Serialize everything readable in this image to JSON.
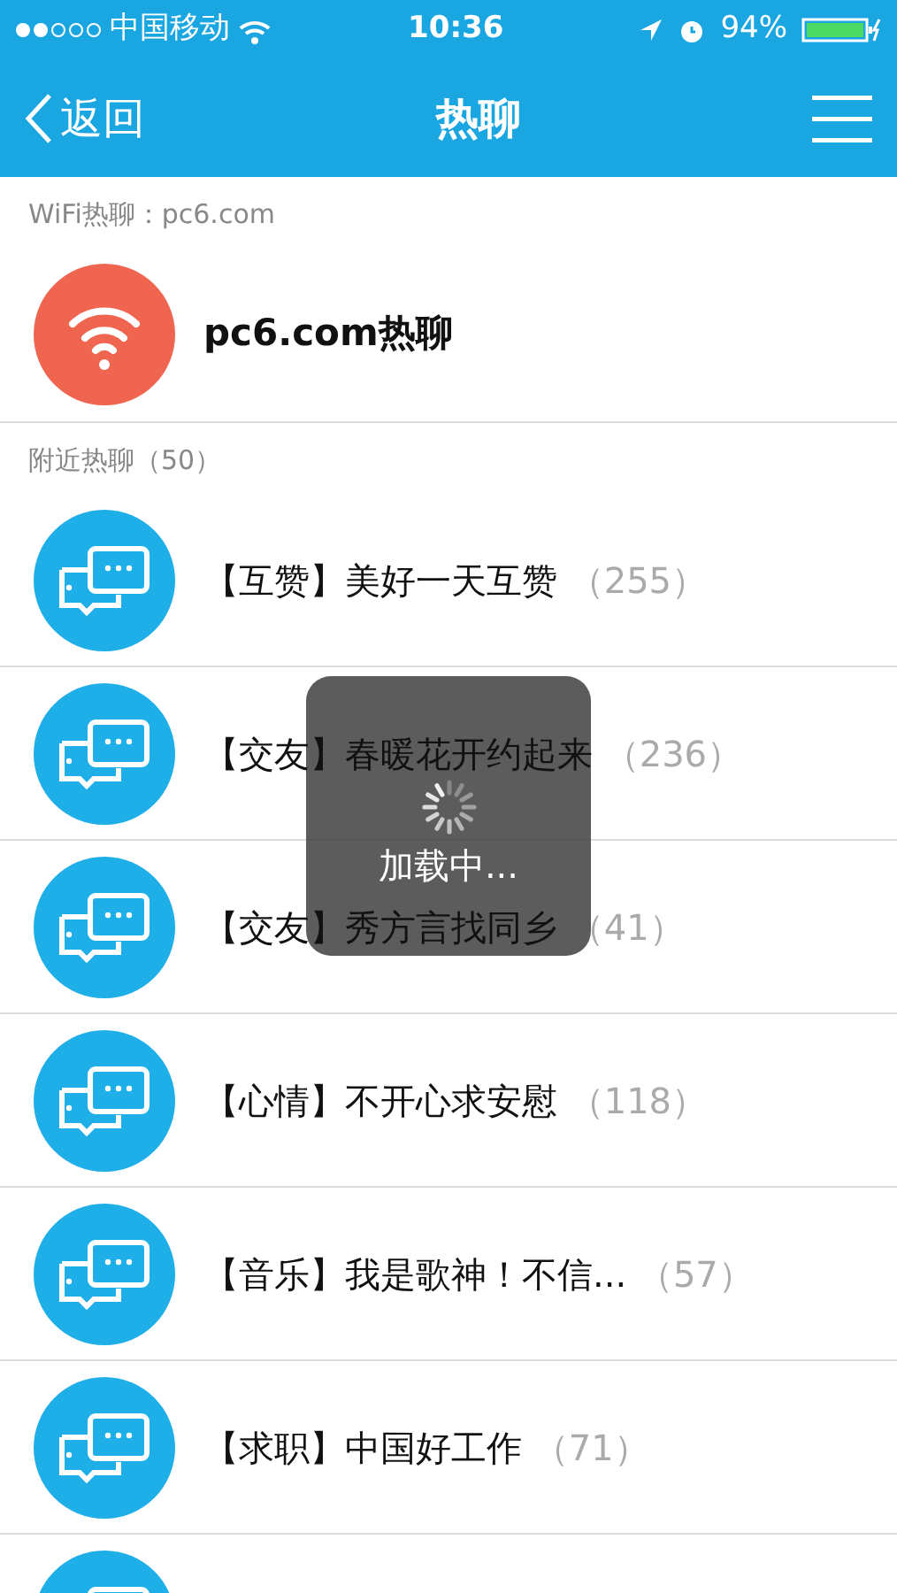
{
  "status_bar": {
    "carrier": "中国移动",
    "time": "10:36",
    "battery": "94%"
  },
  "nav": {
    "back": "返回",
    "title": "热聊"
  },
  "wifi_section": {
    "header": "WiFi热聊：pc6.com",
    "item": {
      "name": "pc6.com热聊"
    }
  },
  "nearby_section": {
    "header": "附近热聊（50）",
    "items": [
      {
        "kind": "room",
        "tag": "【互赞】",
        "name": "美好一天互赞",
        "count": "（255）"
      },
      {
        "kind": "room",
        "tag": "【交友】",
        "name": "春暖花开约起来",
        "count": "（236）"
      },
      {
        "kind": "room",
        "tag": "【交友】",
        "name": "秀方言找同乡",
        "count": "（41）"
      },
      {
        "kind": "room",
        "tag": "【心情】",
        "name": "不开心求安慰",
        "count": "（118）"
      },
      {
        "kind": "room",
        "tag": "【音乐】",
        "name": "我是歌神！不信...",
        "count": "（57）"
      },
      {
        "kind": "room",
        "tag": "【求职】",
        "name": "中国好工作",
        "count": "（71）"
      },
      {
        "kind": "cut_off"
      }
    ]
  },
  "loading": {
    "text": "加载中..."
  }
}
